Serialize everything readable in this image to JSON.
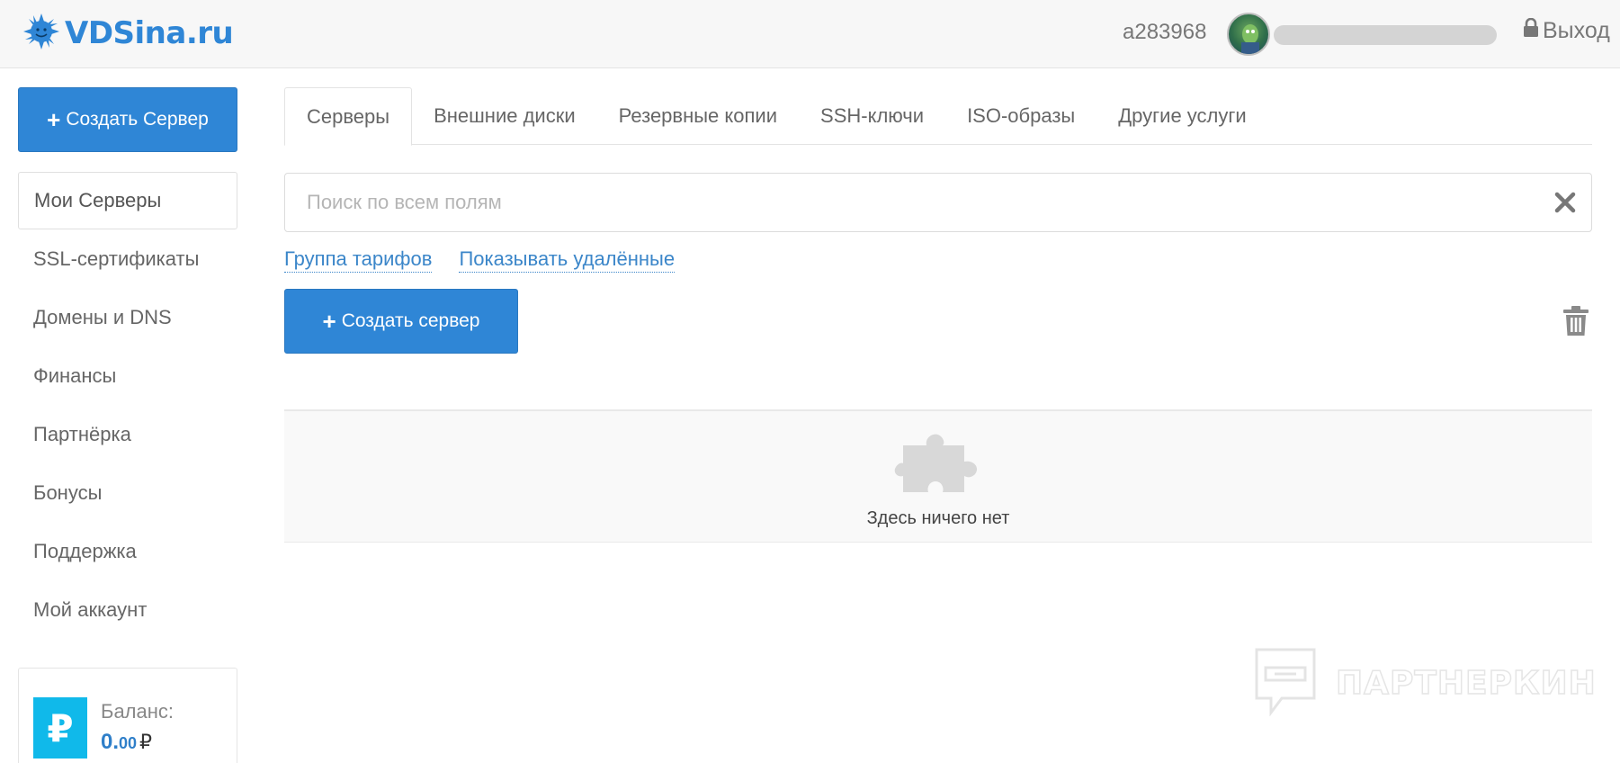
{
  "header": {
    "logo_text": "VDSina.ru",
    "user_id": "a283968",
    "logout_label": "Выход"
  },
  "sidebar": {
    "create_button_label": "Создать Сервер",
    "items": [
      {
        "label": "Мои Серверы",
        "active": true
      },
      {
        "label": "SSL-сертификаты"
      },
      {
        "label": "Домены и DNS"
      },
      {
        "label": "Финансы"
      },
      {
        "label": "Партнёрка"
      },
      {
        "label": "Бонусы"
      },
      {
        "label": "Поддержка"
      },
      {
        "label": "Мой аккаунт"
      }
    ],
    "balance": {
      "label": "Баланс:",
      "integer": "0.",
      "decimal": "00",
      "currency": "₽",
      "icon_glyph": "₽"
    }
  },
  "tabs": [
    {
      "label": "Серверы",
      "active": true
    },
    {
      "label": "Внешние диски"
    },
    {
      "label": "Резервные копии"
    },
    {
      "label": "SSH-ключи"
    },
    {
      "label": "ISO-образы"
    },
    {
      "label": "Другие услуги"
    }
  ],
  "search": {
    "placeholder": "Поиск по всем полям",
    "value": ""
  },
  "filters": {
    "tariff_group": "Группа тарифов",
    "show_deleted": "Показывать удалённые"
  },
  "main": {
    "create_button_label": "Создать сервер",
    "empty_text": "Здесь ничего нет"
  },
  "watermark": {
    "text": "ПАРТНЕРКИН"
  },
  "colors": {
    "accent": "#2f86d6",
    "link": "#3b86c9",
    "balance_icon": "#10b9ea"
  }
}
